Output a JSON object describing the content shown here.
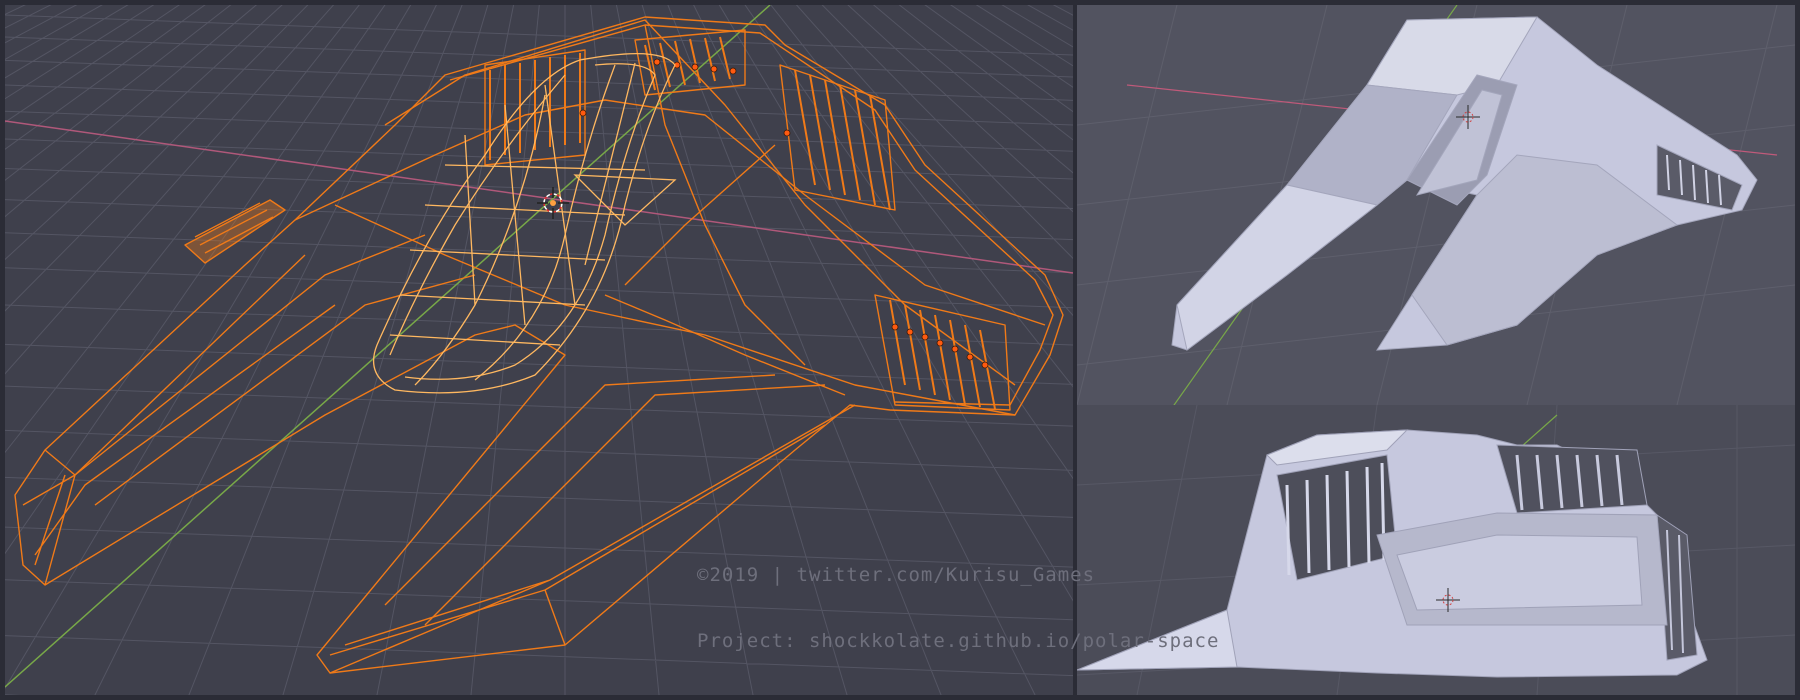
{
  "watermark": {
    "line1": "©2019 | twitter.com/Kurisu_Games",
    "line2": "Project: shockkolate.github.io/polar-space"
  },
  "colors": {
    "background": "#2b2c36",
    "viewport_main": "#3f404c",
    "viewport_right_top": "#525360",
    "viewport_right_bottom": "#4b4c58",
    "grid": "#5a5b68",
    "axis_x": "#c05a7a",
    "axis_y": "#7ab040",
    "wireframe_selected": "#f07a18",
    "wireframe_active": "#ffc070",
    "solid_shading": "#c4c6dc",
    "solid_shadow": "#8d8fa4"
  },
  "views": [
    {
      "name": "wireframe-perspective",
      "shading": "wireframe"
    },
    {
      "name": "solid-top",
      "shading": "solid"
    },
    {
      "name": "solid-front",
      "shading": "solid"
    }
  ],
  "icons": [
    "origin-cursor-icon"
  ]
}
